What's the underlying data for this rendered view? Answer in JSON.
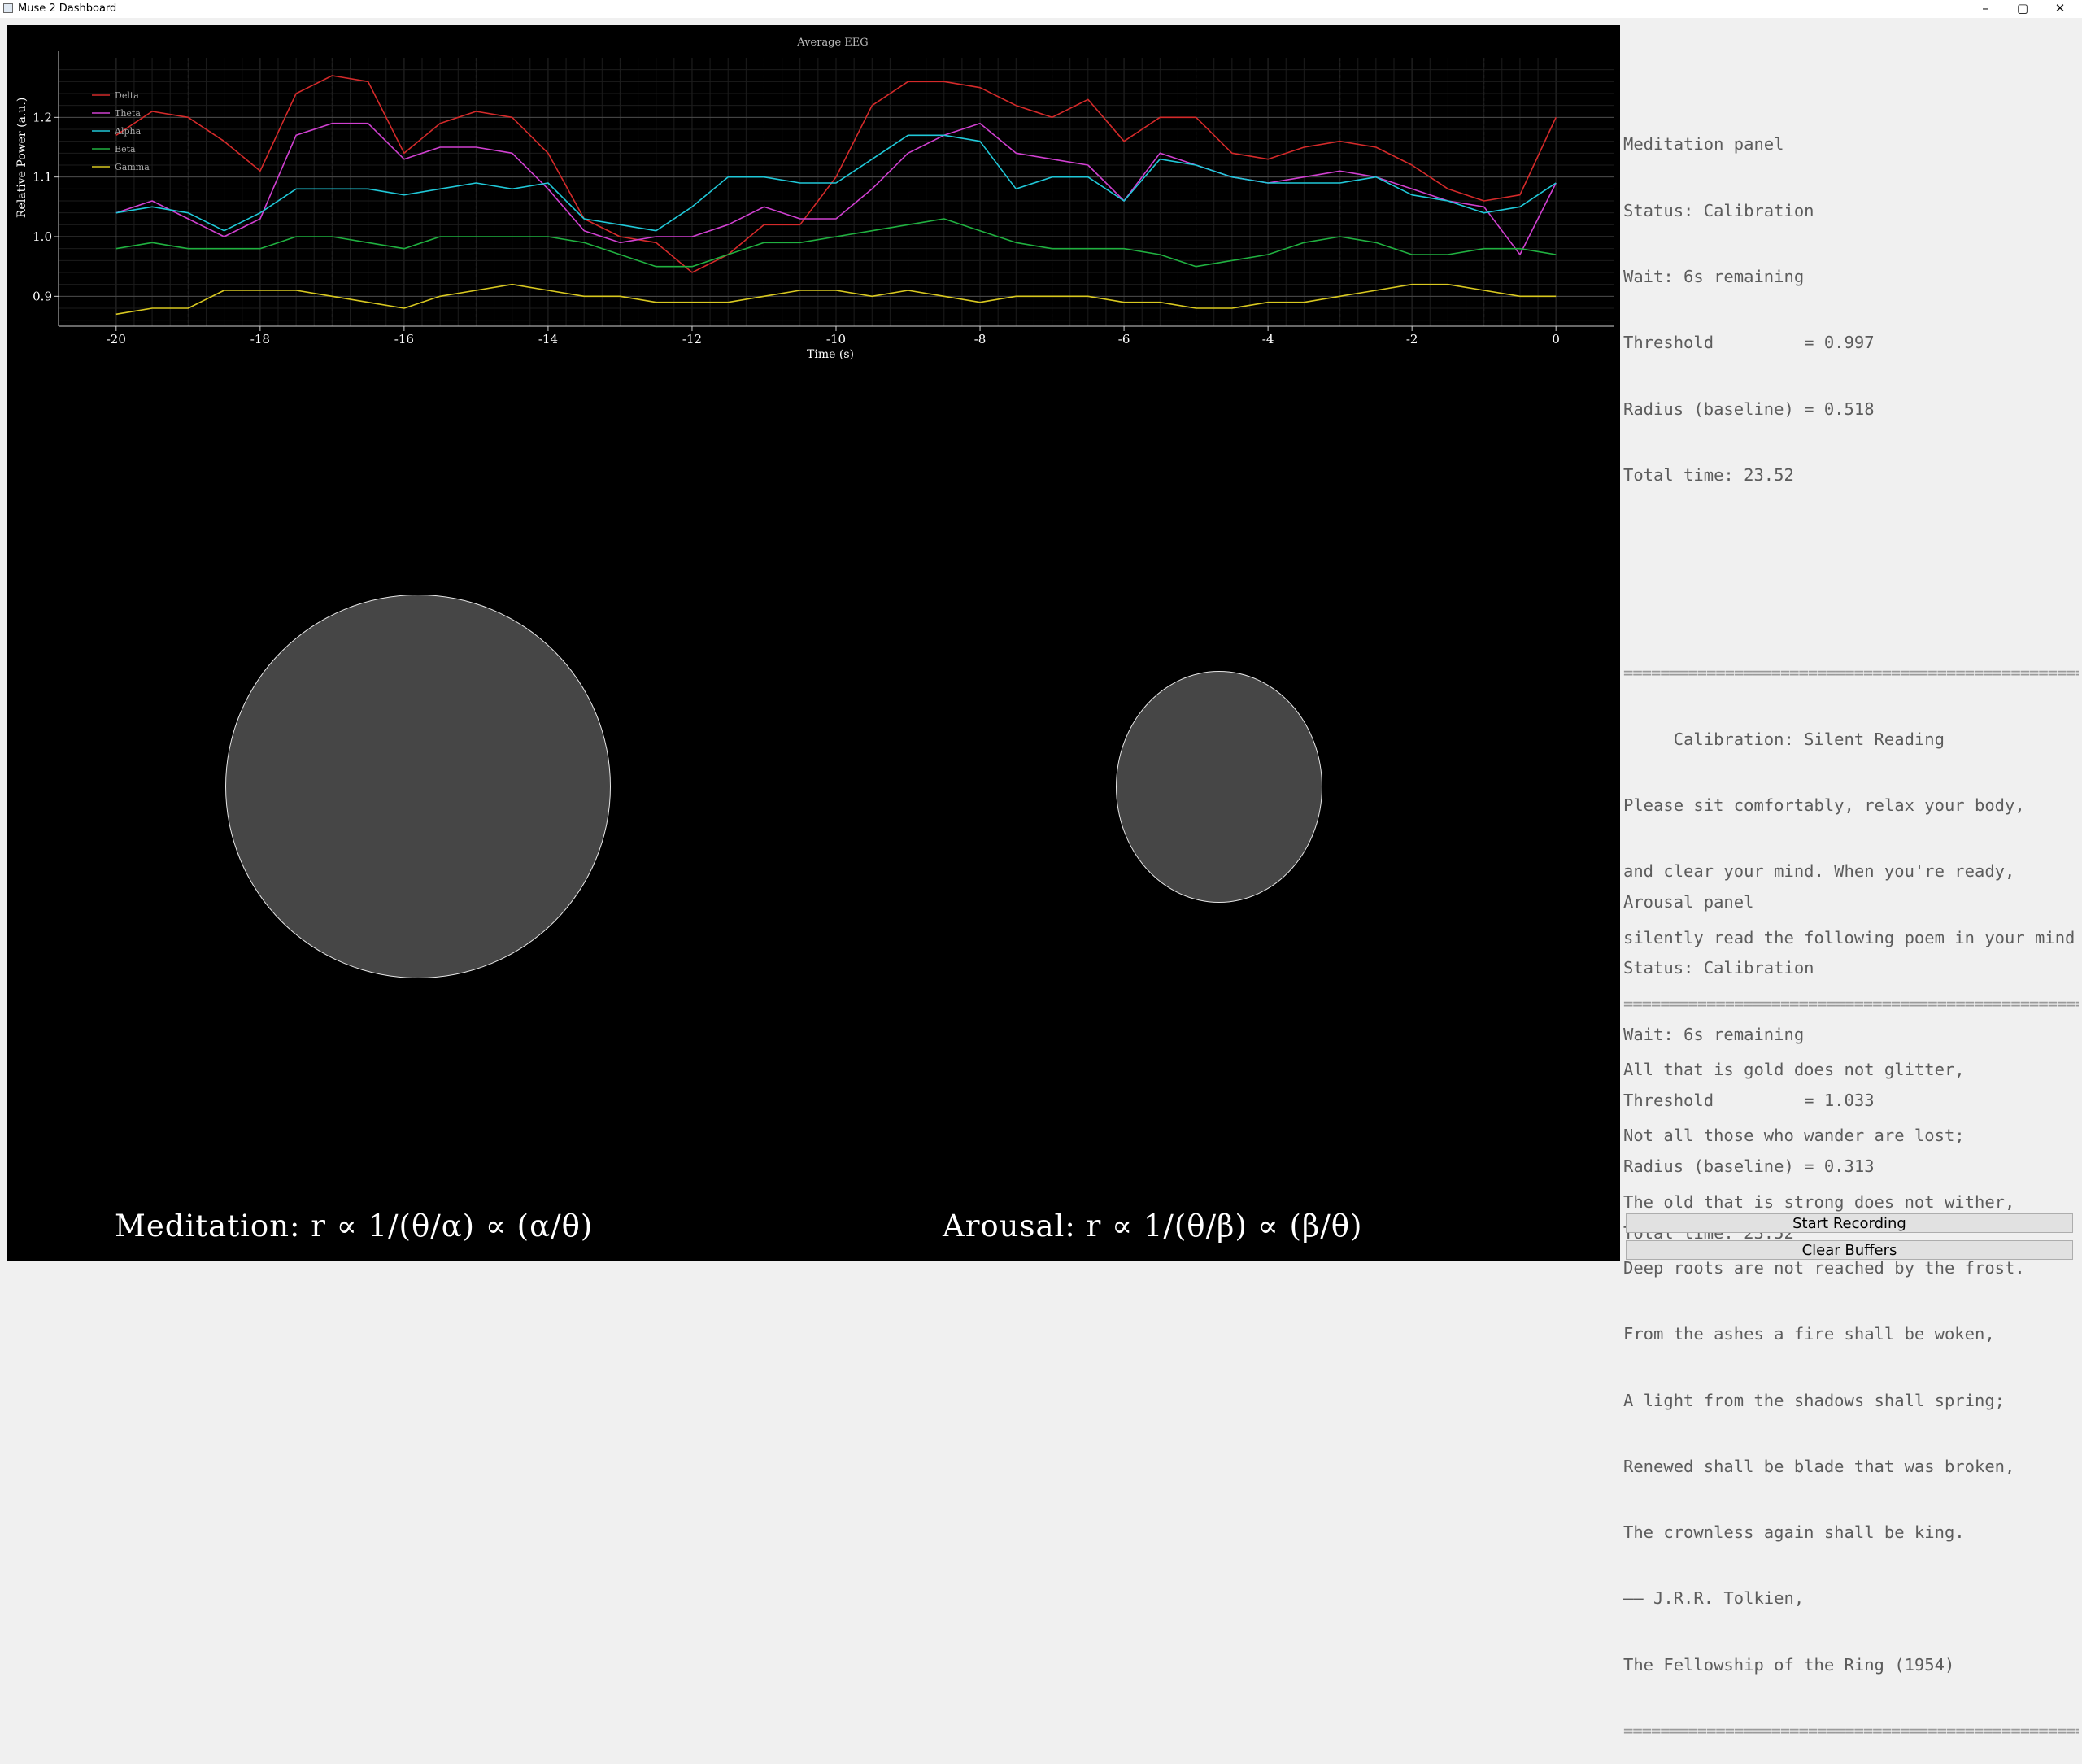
{
  "window": {
    "title": "Muse 2 Dashboard",
    "controls": {
      "minimize": "–",
      "maximize": "▢",
      "close": "✕"
    }
  },
  "chart_data": {
    "type": "line",
    "title": "Average EEG",
    "xlabel": "Time (s)",
    "ylabel": "Relative Power (a.u.)",
    "xlim": [
      -20.8,
      0.8
    ],
    "ylim": [
      0.85,
      1.3
    ],
    "x_ticks": [
      -20,
      -18,
      -16,
      -14,
      -12,
      -10,
      -8,
      -6,
      -4,
      -2,
      0
    ],
    "y_ticks": [
      0.9,
      1.0,
      1.1,
      1.2
    ],
    "y_tick_labels": [
      "0.9",
      "1.0",
      "1.1",
      "1.2"
    ],
    "grid": true,
    "legend_position": "top-left",
    "x": [
      -20,
      -19.5,
      -19,
      -18.5,
      -18,
      -17.5,
      -17,
      -16.5,
      -16,
      -15.5,
      -15,
      -14.5,
      -14,
      -13.5,
      -13,
      -12.5,
      -12,
      -11.5,
      -11,
      -10.5,
      -10,
      -9.5,
      -9,
      -8.5,
      -8,
      -7.5,
      -7,
      -6.5,
      -6,
      -5.5,
      -5,
      -4.5,
      -4,
      -3.5,
      -3,
      -2.5,
      -2,
      -1.5,
      -1,
      -0.5,
      0
    ],
    "series": [
      {
        "name": "Delta",
        "color": "#d42a2a",
        "values": [
          1.17,
          1.21,
          1.2,
          1.16,
          1.11,
          1.24,
          1.27,
          1.26,
          1.14,
          1.19,
          1.21,
          1.2,
          1.14,
          1.03,
          1.0,
          0.99,
          0.94,
          0.97,
          1.02,
          1.02,
          1.1,
          1.22,
          1.26,
          1.26,
          1.25,
          1.22,
          1.2,
          1.23,
          1.16,
          1.2,
          1.2,
          1.14,
          1.13,
          1.15,
          1.16,
          1.15,
          1.12,
          1.08,
          1.06,
          1.07,
          1.2
        ]
      },
      {
        "name": "Theta",
        "color": "#d040d0",
        "values": [
          1.04,
          1.06,
          1.03,
          1.0,
          1.03,
          1.17,
          1.19,
          1.19,
          1.13,
          1.15,
          1.15,
          1.14,
          1.08,
          1.01,
          0.99,
          1.0,
          1.0,
          1.02,
          1.05,
          1.03,
          1.03,
          1.08,
          1.14,
          1.17,
          1.19,
          1.14,
          1.13,
          1.12,
          1.06,
          1.14,
          1.12,
          1.1,
          1.09,
          1.1,
          1.11,
          1.1,
          1.08,
          1.06,
          1.05,
          0.97,
          1.09
        ]
      },
      {
        "name": "Alpha",
        "color": "#20c8d8",
        "values": [
          1.04,
          1.05,
          1.04,
          1.01,
          1.04,
          1.08,
          1.08,
          1.08,
          1.07,
          1.08,
          1.09,
          1.08,
          1.09,
          1.03,
          1.02,
          1.01,
          1.05,
          1.1,
          1.1,
          1.09,
          1.09,
          1.13,
          1.17,
          1.17,
          1.16,
          1.08,
          1.1,
          1.1,
          1.06,
          1.13,
          1.12,
          1.1,
          1.09,
          1.09,
          1.09,
          1.1,
          1.07,
          1.06,
          1.04,
          1.05,
          1.09
        ]
      },
      {
        "name": "Beta",
        "color": "#20b040",
        "values": [
          0.98,
          0.99,
          0.98,
          0.98,
          0.98,
          1.0,
          1.0,
          0.99,
          0.98,
          1.0,
          1.0,
          1.0,
          1.0,
          0.99,
          0.97,
          0.95,
          0.95,
          0.97,
          0.99,
          0.99,
          1.0,
          1.01,
          1.02,
          1.03,
          1.01,
          0.99,
          0.98,
          0.98,
          0.98,
          0.97,
          0.95,
          0.96,
          0.97,
          0.99,
          1.0,
          0.99,
          0.97,
          0.97,
          0.98,
          0.98,
          0.97
        ]
      },
      {
        "name": "Gamma",
        "color": "#d8c820",
        "values": [
          0.87,
          0.88,
          0.88,
          0.91,
          0.91,
          0.91,
          0.9,
          0.89,
          0.88,
          0.9,
          0.91,
          0.92,
          0.91,
          0.9,
          0.9,
          0.89,
          0.89,
          0.89,
          0.9,
          0.91,
          0.91,
          0.9,
          0.91,
          0.9,
          0.89,
          0.9,
          0.9,
          0.9,
          0.89,
          0.89,
          0.88,
          0.88,
          0.89,
          0.89,
          0.9,
          0.91,
          0.92,
          0.92,
          0.91,
          0.9,
          0.9
        ]
      }
    ]
  },
  "visuals": {
    "meditation_radius": 0.518,
    "arousal_radius": 0.313,
    "circle_fill": "#464646",
    "circle_outline": "#e6e6e6"
  },
  "formulas": {
    "meditation": "Meditation: r ∝ 1/(θ/α) ∝ (α/θ)",
    "arousal": "Arousal: r ∝ 1/(θ/β) ∝ (β/θ)"
  },
  "meditation_panel": {
    "lines": [
      "Meditation panel",
      "Status: Calibration",
      "Wait: 6s remaining",
      "Threshold         = 0.997",
      "Radius (baseline) = 0.518",
      "Total time: 23.52"
    ]
  },
  "calibration": {
    "separator": "==================================================",
    "title": "     Calibration: Silent Reading",
    "instructions": [
      "Please sit comfortably, relax your body,",
      "and clear your mind. When you're ready,",
      "silently read the following poem in your mind:"
    ],
    "poem": [
      "All that is gold does not glitter,",
      "Not all those who wander are lost;",
      "The old that is strong does not wither,",
      "Deep roots are not reached by the frost.",
      "From the ashes a fire shall be woken,",
      "A light from the shadows shall spring;",
      "Renewed shall be blade that was broken,",
      "The crownless again shall be king."
    ],
    "attribution": [
      "—— J.R.R. Tolkien,",
      "The Fellowship of the Ring (1954)"
    ]
  },
  "arousal_panel": {
    "lines": [
      "Arousal panel",
      "Status: Calibration",
      "Wait: 6s remaining",
      "Threshold         = 1.033",
      "Radius (baseline) = 0.313",
      "Total time: 23.52"
    ]
  },
  "buttons": {
    "start_recording": "Start Recording",
    "clear_buffers": "Clear Buffers"
  }
}
